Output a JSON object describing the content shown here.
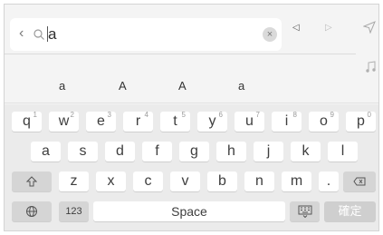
{
  "search": {
    "back_icon": "chevron-left-icon",
    "search_icon": "magnifier-icon",
    "query": "a",
    "clear_icon": "close-icon",
    "cursor_left_icon": "triangle-left-icon",
    "cursor_right_icon": "triangle-right-icon",
    "send_icon": "paper-plane-icon",
    "music_icon": "music-note-icon"
  },
  "candidates": [
    "a",
    "A",
    "A",
    "a"
  ],
  "keyboard": {
    "row1": [
      {
        "label": "q",
        "alt": "1"
      },
      {
        "label": "w",
        "alt": "2"
      },
      {
        "label": "e",
        "alt": "3"
      },
      {
        "label": "r",
        "alt": "4"
      },
      {
        "label": "t",
        "alt": "5"
      },
      {
        "label": "y",
        "alt": "6"
      },
      {
        "label": "u",
        "alt": "7"
      },
      {
        "label": "i",
        "alt": "8"
      },
      {
        "label": "o",
        "alt": "9"
      },
      {
        "label": "p",
        "alt": "0"
      }
    ],
    "row2": [
      "a",
      "s",
      "d",
      "f",
      "g",
      "h",
      "j",
      "k",
      "l"
    ],
    "row3": [
      "z",
      "x",
      "c",
      "v",
      "b",
      "n",
      "m",
      "."
    ],
    "space_label": "Space",
    "numbers_label": "123",
    "confirm_label": "確定",
    "shift_icon": "shift-arrow-icon",
    "backspace_icon": "backspace-icon",
    "globe_icon": "globe-icon",
    "hide_keyboard_icon": "keyboard-hide-icon"
  },
  "colors": {
    "background": "#f4f4f4",
    "key": "#ffffff",
    "key_dark": "#d5d5d5",
    "confirm_key": "#cfcfcf"
  }
}
